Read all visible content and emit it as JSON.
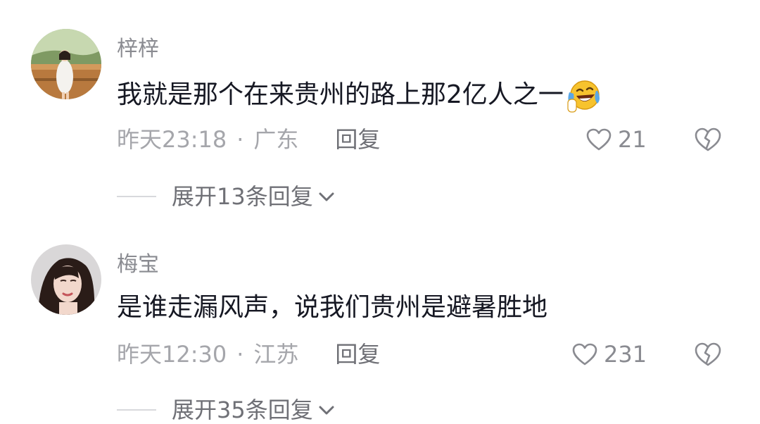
{
  "comments": [
    {
      "username": "梓梓",
      "content": "我就是那个在来贵州的路上那2亿人之一",
      "emoji": "laughing-crying-emoji",
      "time": "昨天23:18",
      "separator": "·",
      "location": "广东",
      "reply_label": "回复",
      "likes": "21",
      "expand_label": "展开13条回复"
    },
    {
      "username": "梅宝",
      "content": "是谁走漏风声，说我们贵州是避暑胜地",
      "time": "昨天12:30",
      "separator": "·",
      "location": "江苏",
      "reply_label": "回复",
      "likes": "231",
      "expand_label": "展开35条回复"
    }
  ],
  "colors": {
    "text_primary": "#161823",
    "text_secondary": "#8a8b91",
    "text_meta": "#a5a6ab",
    "emoji_yellow": "#f7c32e",
    "emoji_blue": "#5aa7e6"
  }
}
